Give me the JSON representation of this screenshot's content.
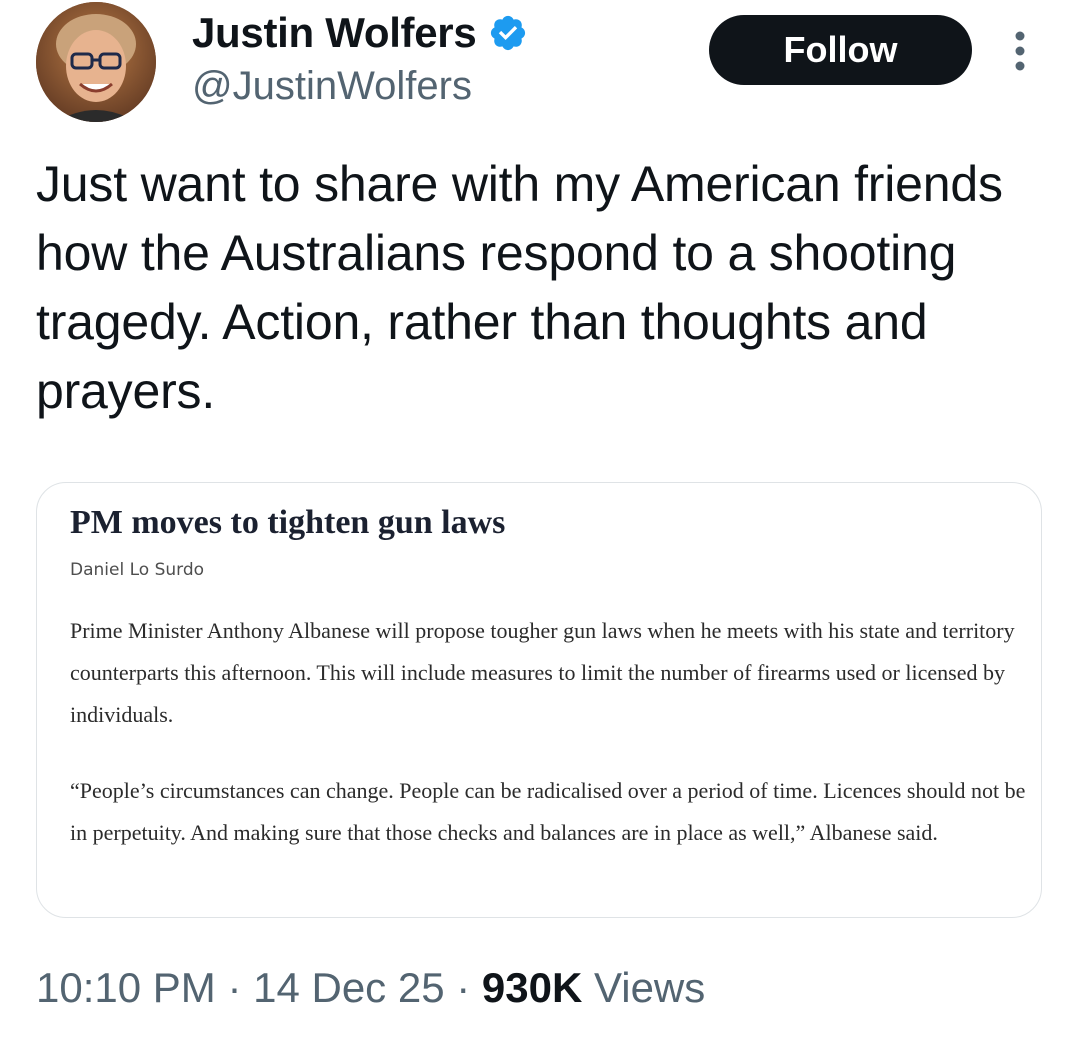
{
  "author": {
    "display_name": "Justin Wolfers",
    "handle": "@JustinWolfers",
    "verified": true,
    "verified_color": "#1d9bf0"
  },
  "follow_button": {
    "label": "Follow"
  },
  "tweet": {
    "text": "Just want to share with my American friends how the Australians respond to a shooting tragedy. Action, rather than thoughts and prayers."
  },
  "article": {
    "headline": "PM moves to tighten gun laws",
    "byline": "Daniel Lo Surdo",
    "paragraphs": [
      "Prime Minister Anthony Albanese will propose tougher gun laws when he meets with his state and territory counterparts this afternoon. This will include measures to limit the number of firearms used or licensed by individuals.",
      "“People’s circumstances can change. People can be radicalised over a period of time. Licences should not be in perpetuity. And making sure that those checks and balances are in place as well,” Albanese said."
    ]
  },
  "meta": {
    "time": "10:10 PM",
    "separator": " · ",
    "date": "14 Dec 25",
    "views_count": "930K",
    "views_label": "Views"
  },
  "icons": {
    "avatar": "profile-photo",
    "verified": "verified-badge-icon",
    "more": "more-options-icon"
  },
  "colors": {
    "follow_bg": "#0f1419",
    "secondary_text": "#536471",
    "card_border": "#dfe3e6"
  }
}
